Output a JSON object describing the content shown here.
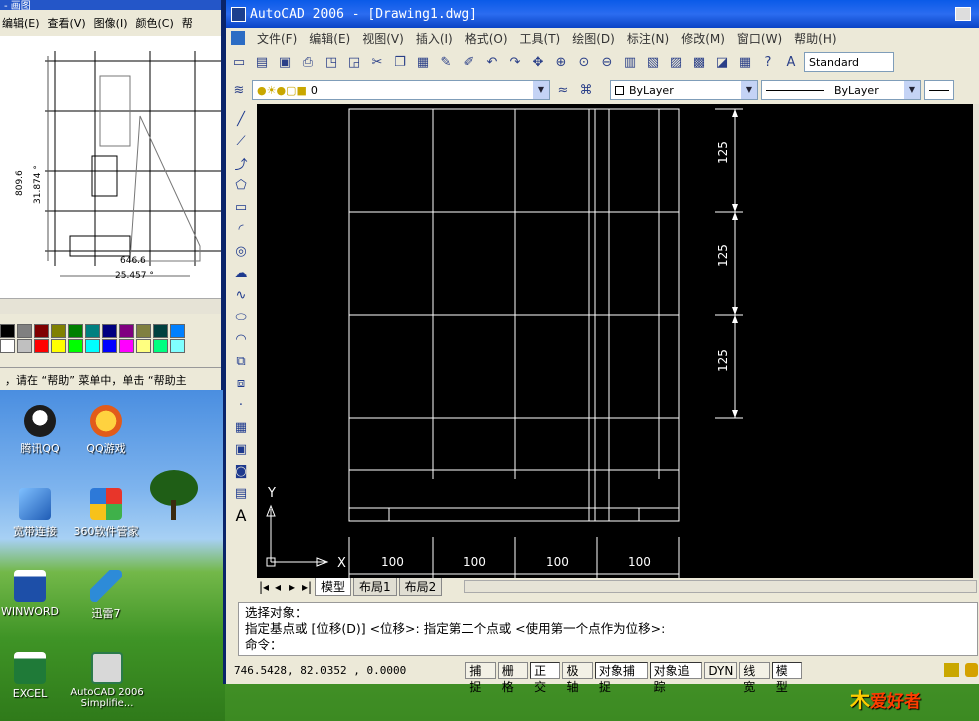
{
  "paint": {
    "title": "- 画图",
    "menu": [
      "编辑(E)",
      "查看(V)",
      "图像(I)",
      "颜色(C)",
      "帮"
    ],
    "canvas_labels": [
      "809.6",
      "31.874 °",
      "646.6",
      "25.457 °"
    ],
    "status": "，请在 “帮助” 菜单中，单击 “帮助主",
    "palette_colors": [
      "#000000",
      "#808080",
      "#800000",
      "#808000",
      "#008000",
      "#008080",
      "#000080",
      "#800080",
      "#808040",
      "#004040",
      "#0080ff",
      "#ffffff",
      "#c0c0c0",
      "#ff0000",
      "#ffff00",
      "#00ff00",
      "#00ffff",
      "#0000ff",
      "#ff00ff",
      "#ffff80",
      "#00ff80",
      "#80ffff"
    ]
  },
  "desktop": {
    "icons": [
      {
        "label": "腾讯QQ",
        "icon": "qq-icon",
        "color": "#1c1c1c"
      },
      {
        "label": "QQ游戏",
        "icon": "qq-game-icon",
        "color": "#f0a020"
      },
      {
        "label": "宽带连接",
        "icon": "broadband-icon",
        "color": "#3a7fd0"
      },
      {
        "label": "360软件管家",
        "icon": "360-icon",
        "color": "#e8352a"
      },
      {
        "label": "WINWORD",
        "icon": "word-icon",
        "color": "#1d4fa8"
      },
      {
        "label": "迅雷7",
        "icon": "xunlei-icon",
        "color": "#2d8bd8"
      },
      {
        "label": "EXCEL",
        "icon": "excel-icon",
        "color": "#1f7a38"
      },
      {
        "label": "AutoCAD 2006 Simplifie...",
        "icon": "autocad-icon",
        "color": "#d8d8d8"
      }
    ],
    "watermark": "爱好者"
  },
  "acad": {
    "title": "AutoCAD 2006 - [Drawing1.dwg]",
    "menu": [
      "文件(F)",
      "编辑(E)",
      "视图(V)",
      "插入(I)",
      "格式(O)",
      "工具(T)",
      "绘图(D)",
      "标注(N)",
      "修改(M)",
      "窗口(W)",
      "帮助(H)"
    ],
    "text_style": "Standard",
    "layer": "0",
    "color": "ByLayer",
    "linetype": "ByLayer",
    "ucs": {
      "x": "X",
      "y": "Y"
    },
    "dims_vertical": [
      "125",
      "125",
      "125"
    ],
    "dims_horizontal": [
      "100",
      "100",
      "100",
      "100"
    ],
    "tabs": [
      "模型",
      "布局1",
      "布局2"
    ],
    "command_lines": [
      "选择对象：",
      "指定基点或 [位移(D)] <位移>:  指定第二个点或 <使用第一个点作为位移>:",
      "命令："
    ],
    "coords": "746.5428,   82.0352 , 0.0000",
    "status_buttons": [
      {
        "label": "捕捉",
        "on": false
      },
      {
        "label": "栅格",
        "on": false
      },
      {
        "label": "正交",
        "on": true
      },
      {
        "label": "极轴",
        "on": false
      },
      {
        "label": "对象捕捉",
        "on": true
      },
      {
        "label": "对象追踪",
        "on": true
      },
      {
        "label": "DYN",
        "on": false
      },
      {
        "label": "线宽",
        "on": false
      },
      {
        "label": "模型",
        "on": true
      }
    ]
  }
}
